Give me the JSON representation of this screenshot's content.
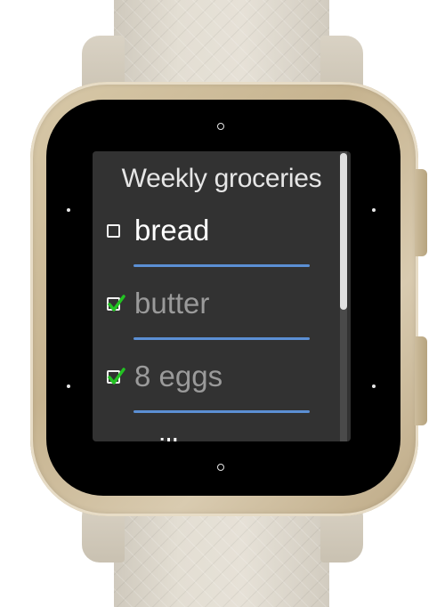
{
  "app": {
    "title": "Weekly groceries"
  },
  "list": {
    "items": [
      {
        "label": "bread",
        "checked": false
      },
      {
        "label": "butter",
        "checked": true
      },
      {
        "label": "8 eggs",
        "checked": true
      },
      {
        "label": "milk",
        "checked": false
      }
    ]
  },
  "scroll": {
    "position_fraction": 0.0,
    "visible_fraction": 0.54
  },
  "colors": {
    "screen_bg": "#323232",
    "divider": "#5b8fd4",
    "checkmark": "#22c322",
    "checked_text": "#9a9a9a",
    "unchecked_text": "#ffffff",
    "case": "#c6b38f",
    "strap": "#e3ded3"
  },
  "icons": {
    "checkbox_empty": "checkbox-empty-icon",
    "checkbox_checked": "checkbox-checked-icon"
  }
}
